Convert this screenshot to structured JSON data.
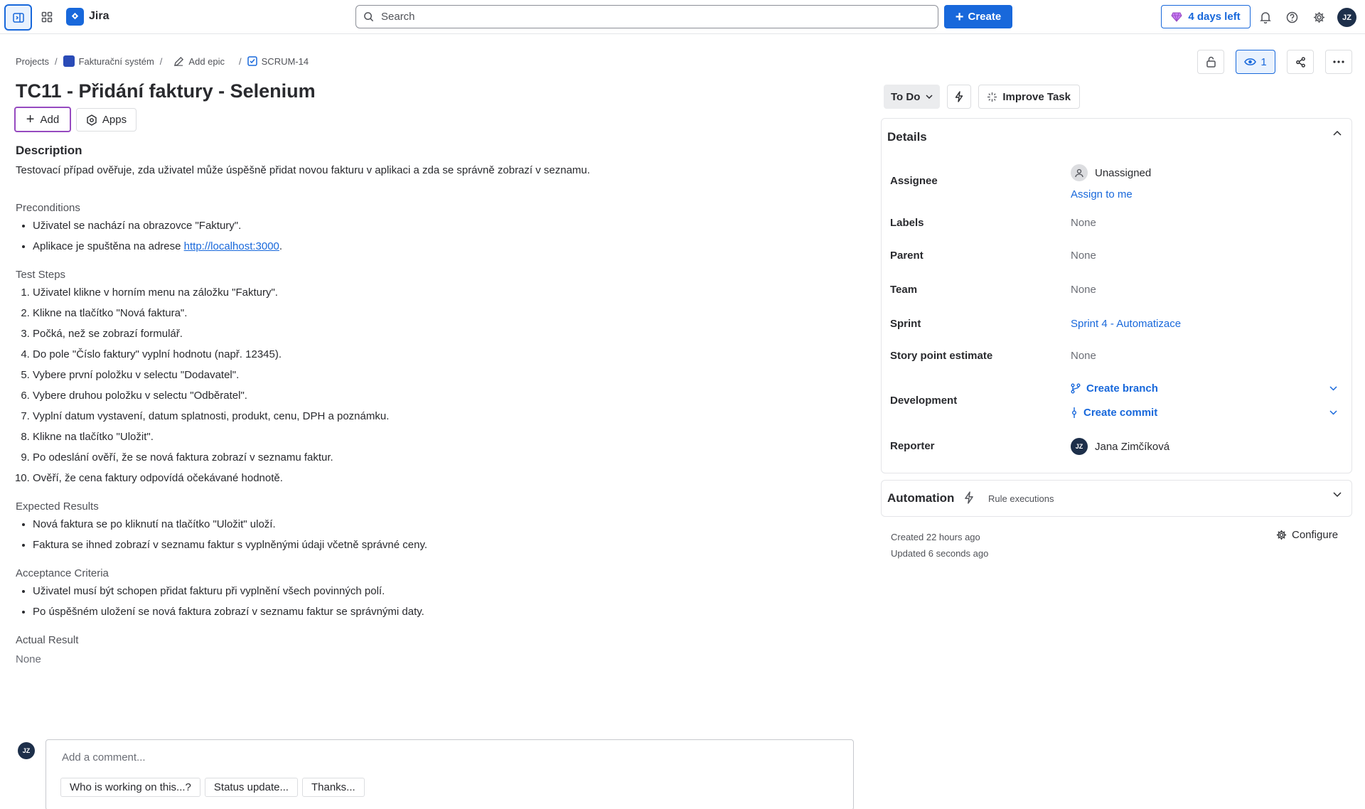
{
  "nav": {
    "app_name": "Jira",
    "search_placeholder": "Search",
    "create_label": "Create",
    "trial_label": "4 days left",
    "user_initials": "JZ"
  },
  "breadcrumb": {
    "projects": "Projects",
    "project": "Fakturační systém",
    "epic": "Add epic",
    "issue_key": "SCRUM-14"
  },
  "watchers_count": "1",
  "issue": {
    "title": "TC11 - Přidání faktury - Selenium",
    "add_label": "Add",
    "apps_label": "Apps"
  },
  "description": {
    "heading": "Description",
    "intro": "Testovací případ ověřuje, zda uživatel může úspěšně přidat novou fakturu v aplikaci a zda se správně zobrazí v seznamu.",
    "preconditions_title": "Preconditions",
    "preconditions": {
      "item1": "Uživatel se nachází na obrazovce \"Faktury\".",
      "item2_prefix": "Aplikace je spuštěna na adrese ",
      "item2_link": "http://localhost:3000",
      "item2_suffix": "."
    },
    "steps_title": "Test Steps",
    "steps": [
      "Uživatel klikne v horním menu na záložku \"Faktury\".",
      "Klikne na tlačítko \"Nová faktura\".",
      "Počká, než se zobrazí formulář.",
      "Do pole \"Číslo faktury\" vyplní hodnotu (např. 12345).",
      "Vybere první položku v selectu \"Dodavatel\".",
      "Vybere druhou položku v selectu \"Odběratel\".",
      "Vyplní datum vystavení, datum splatnosti, produkt, cenu, DPH a poznámku.",
      "Klikne na tlačítko \"Uložit\".",
      "Po odeslání ověří, že se nová faktura zobrazí v seznamu faktur.",
      "Ověří, že cena faktury odpovídá očekávané hodnotě."
    ],
    "expected_title": "Expected Results",
    "expected": [
      "Nová faktura se po kliknutí na tlačítko \"Uložit\" uloží.",
      "Faktura se ihned zobrazí v seznamu faktur s vyplněnými údaji včetně správné ceny."
    ],
    "acceptance_title": "Acceptance Criteria",
    "acceptance": [
      "Uživatel musí být schopen přidat fakturu při vyplnění všech povinných polí.",
      "Po úspěšném uložení se nová faktura zobrazí v seznamu faktur se správnými daty."
    ],
    "actual_title": "Actual Result",
    "actual_value": "None"
  },
  "comment": {
    "avatar_initials": "JZ",
    "placeholder": "Add a comment...",
    "quick_replies": [
      "Who is working on this...?",
      "Status update...",
      "Thanks..."
    ]
  },
  "status": {
    "label": "To Do",
    "improve_label": "Improve Task"
  },
  "details": {
    "heading": "Details",
    "assignee_label": "Assignee",
    "assignee_value": "Unassigned",
    "assign_to_me": "Assign to me",
    "labels_label": "Labels",
    "labels_value": "None",
    "parent_label": "Parent",
    "parent_value": "None",
    "team_label": "Team",
    "team_value": "None",
    "sprint_label": "Sprint",
    "sprint_value": "Sprint 4 - Automatizace",
    "story_points_label": "Story point estimate",
    "story_points_value": "None",
    "development_label": "Development",
    "create_branch": "Create branch",
    "create_commit": "Create commit",
    "reporter_label": "Reporter",
    "reporter_initials": "JZ",
    "reporter_value": "Jana Zimčíková"
  },
  "automation": {
    "title": "Automation",
    "rule_executions": "Rule executions"
  },
  "meta": {
    "created": "Created 22 hours ago",
    "updated": "Updated 6 seconds ago",
    "configure": "Configure"
  },
  "colors": {
    "accent": "#1868db",
    "add_border": "#964ac0",
    "avatar_bg": "#1d2f4a"
  }
}
